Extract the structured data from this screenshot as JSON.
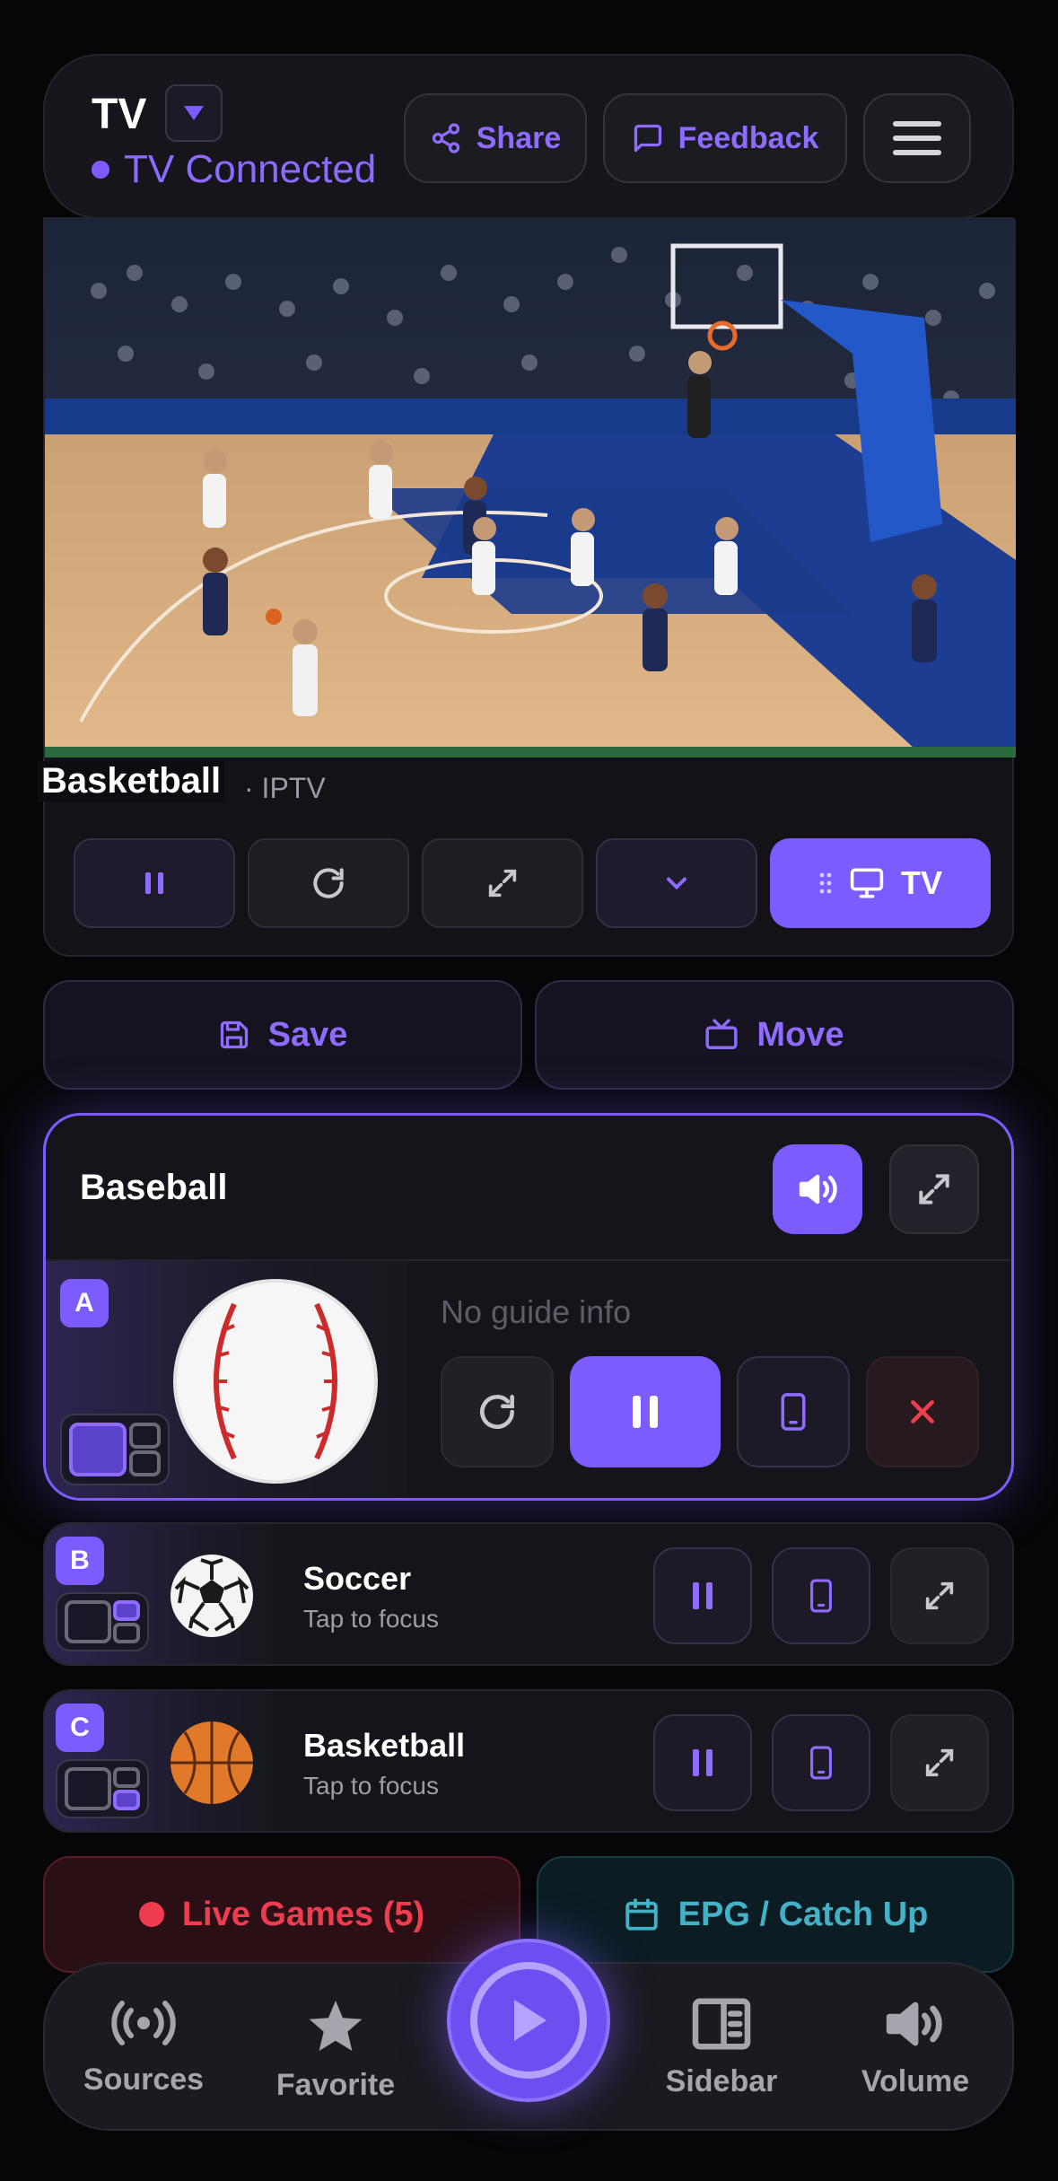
{
  "header": {
    "title": "TV",
    "status_text": "TV Connected",
    "share_label": "Share",
    "feedback_label": "Feedback"
  },
  "player": {
    "title": "Basketball",
    "source": "· IPTV",
    "tv_button_label": "TV"
  },
  "actions": {
    "save_label": "Save",
    "move_label": "Move"
  },
  "focused_slot": {
    "badge": "A",
    "title": "Baseball",
    "guide_text": "No guide info"
  },
  "slots": [
    {
      "badge": "B",
      "title": "Soccer",
      "subtitle": "Tap to focus"
    },
    {
      "badge": "C",
      "title": "Basketball",
      "subtitle": "Tap to focus"
    }
  ],
  "pills": {
    "live_label": "Live Games (5)",
    "epg_label": "EPG / Catch Up"
  },
  "nav": {
    "sources": "Sources",
    "favorite": "Favorite",
    "sidebar": "Sidebar",
    "volume": "Volume"
  },
  "colors": {
    "accent": "#7c5cff",
    "live": "#ef3d4f",
    "epg": "#43b2c8",
    "background": "#060608"
  }
}
